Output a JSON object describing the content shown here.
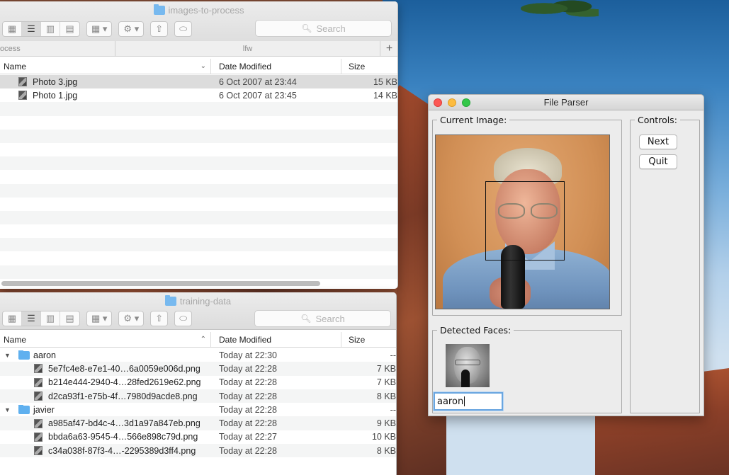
{
  "finder_top": {
    "title": "images-to-process",
    "search_placeholder": "Search",
    "path": [
      "ocess",
      "lfw"
    ],
    "columns": {
      "name": "Name",
      "date": "Date Modified",
      "size": "Size"
    },
    "rows": [
      {
        "name": "Photo 3.jpg",
        "date": "6 Oct 2007 at 23:44",
        "size": "15 KB",
        "selected": true
      },
      {
        "name": "Photo 1.jpg",
        "date": "6 Oct 2007 at 23:45",
        "size": "14 KB",
        "selected": false
      }
    ]
  },
  "finder_bottom": {
    "title": "training-data",
    "search_placeholder": "Search",
    "columns": {
      "name": "Name",
      "date": "Date Modified",
      "size": "Size"
    },
    "rows": [
      {
        "type": "folder",
        "name": "aaron",
        "date": "Today at 22:30",
        "size": "--"
      },
      {
        "type": "file",
        "name": "5e7fc4e8-e7e1-40…6a0059e006d.png",
        "date": "Today at 22:28",
        "size": "7 KB"
      },
      {
        "type": "file",
        "name": "b214e444-2940-4…28fed2619e62.png",
        "date": "Today at 22:28",
        "size": "7 KB"
      },
      {
        "type": "file",
        "name": "d2ca93f1-e75b-4f…7980d9acde8.png",
        "date": "Today at 22:28",
        "size": "8 KB"
      },
      {
        "type": "folder",
        "name": "javier",
        "date": "Today at 22:28",
        "size": "--"
      },
      {
        "type": "file",
        "name": "a985af47-bd4c-4…3d1a97a847eb.png",
        "date": "Today at 22:28",
        "size": "9 KB"
      },
      {
        "type": "file",
        "name": "bbda6a63-9545-4…566e898c79d.png",
        "date": "Today at 22:27",
        "size": "10 KB"
      },
      {
        "type": "file",
        "name": "c34a038f-87f3-4…-2295389d3ff4.png",
        "date": "Today at 22:28",
        "size": "8 KB"
      }
    ]
  },
  "parser": {
    "title": "File Parser",
    "current_image_label": "Current Image:",
    "detected_faces_label": "Detected Faces:",
    "controls_label": "Controls:",
    "next_label": "Next",
    "quit_label": "Quit",
    "name_entry_value": "aaron"
  },
  "icons": {
    "search": "search-icon",
    "folder": "folder-icon",
    "image_file": "image-file-icon",
    "disclosure_open": "disclosure-triangle-icon"
  }
}
